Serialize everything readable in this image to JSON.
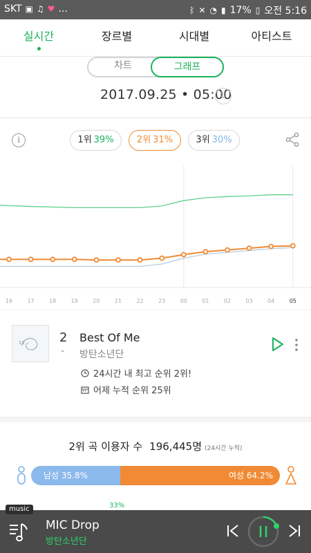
{
  "status_bar": {
    "carrier": "SKT",
    "more": "...",
    "battery": "17%",
    "time": "오전 5:16"
  },
  "tabs": [
    {
      "label": "실시간",
      "active": true
    },
    {
      "label": "장르별",
      "active": false
    },
    {
      "label": "시대별",
      "active": false
    },
    {
      "label": "아티스트",
      "active": false
    }
  ],
  "view_toggle": {
    "chart_label": "차트",
    "graph_label": "그래프",
    "selected": "그래프"
  },
  "datetime": "2017.09.25 • 05:00",
  "rank_pills": [
    {
      "rank": "1위",
      "pct": "39%",
      "color": "#19b25a"
    },
    {
      "rank": "2위",
      "pct": "31%",
      "color": "#f08a34"
    },
    {
      "rank": "3위",
      "pct": "30%",
      "color": "#7fb3e8"
    }
  ],
  "chart_data": {
    "type": "line",
    "x": [
      "16",
      "17",
      "18",
      "19",
      "20",
      "21",
      "22",
      "23",
      "00",
      "01",
      "02",
      "03",
      "04",
      "05"
    ],
    "series": [
      {
        "values": [
          38.0,
          37.8,
          37.7,
          37.6,
          37.6,
          37.6,
          37.6,
          37.9,
          38.8,
          39.3,
          39.5,
          39.6,
          39.8,
          39.8
        ],
        "color": "#5fd08a"
      },
      {
        "values": [
          28.8,
          28.8,
          28.8,
          28.8,
          28.7,
          28.7,
          28.7,
          29.0,
          29.6,
          30.1,
          30.4,
          30.7,
          31.0,
          31.1
        ],
        "color": "#f08a34"
      },
      {
        "values": [
          27.6,
          27.6,
          27.6,
          27.6,
          27.6,
          27.6,
          27.6,
          28.0,
          29.0,
          29.7,
          30.0,
          30.3,
          30.6,
          30.8
        ],
        "color": "#b8ccdd"
      }
    ],
    "ylim": [
      24,
      44
    ],
    "grid": false,
    "highlight_x": [
      "00",
      "05"
    ]
  },
  "song": {
    "rank": "2",
    "change": "-",
    "title": "Best Of Me",
    "artist": "방탄소년단",
    "stat1": "24시간 내 최고 순위 2위!",
    "stat2": "어제 누적 순위 25위"
  },
  "users": {
    "label": "2위 곡 이용자 수",
    "count": "196,445명",
    "note": "(24시간 누적)"
  },
  "gender": {
    "male_label": "남성 35.8%",
    "female_label": "여성 64.2%",
    "male_fraction": 0.358,
    "male_color": "#8cb9ec",
    "female_color": "#f08a34"
  },
  "age_peek": "33%",
  "player": {
    "tag": "music",
    "title": "MIC Drop",
    "artist": "방탄소년단",
    "accent": "#2fd26c"
  }
}
